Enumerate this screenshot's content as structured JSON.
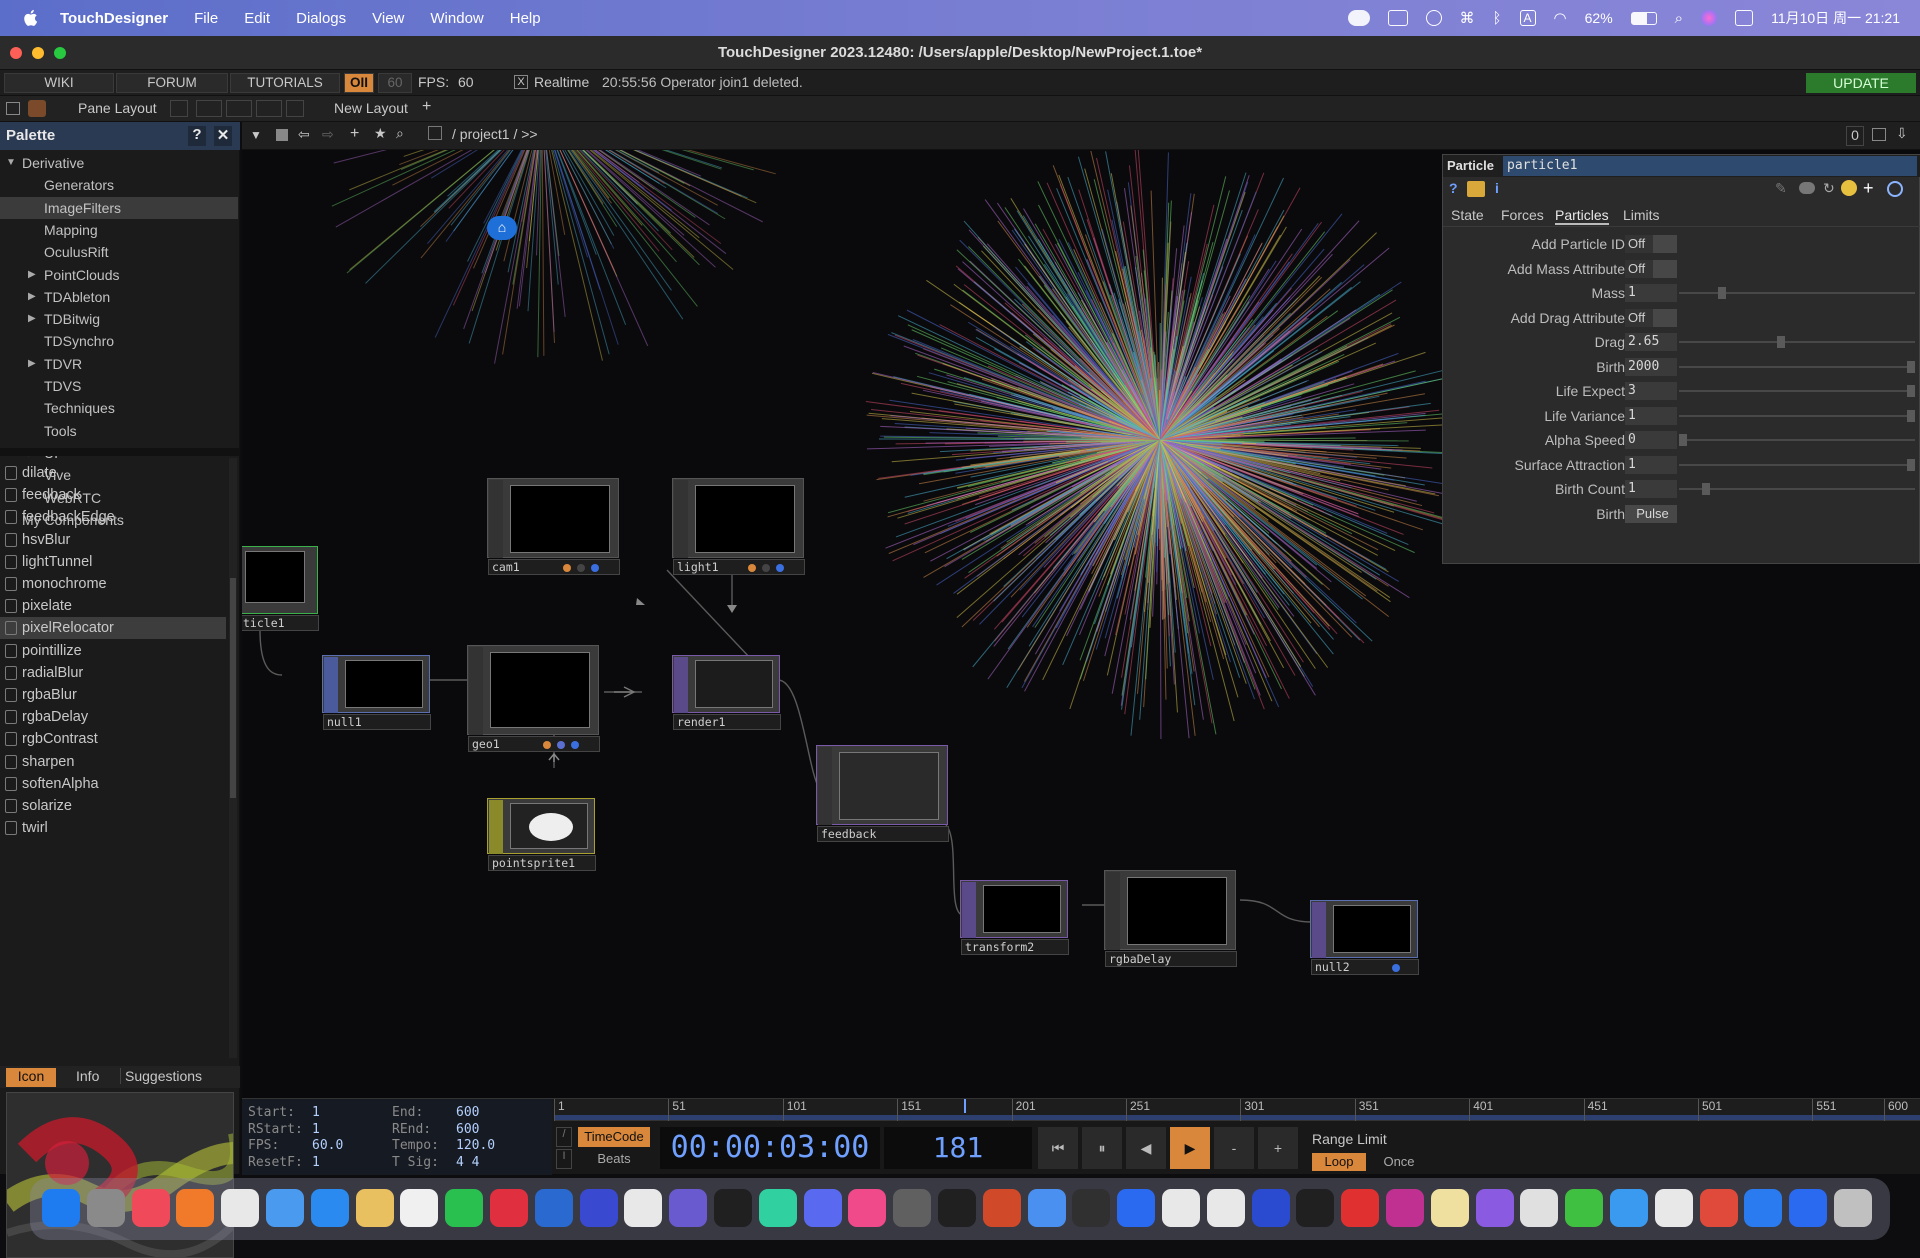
{
  "menubar": {
    "app": "TouchDesigner",
    "items": [
      "File",
      "Edit",
      "Dialogs",
      "View",
      "Window",
      "Help"
    ],
    "battery": "62%",
    "datetime": "11月10日 周一  21:21"
  },
  "window": {
    "title": "TouchDesigner 2023.12480: /Users/apple/Desktop/NewProject.1.toe*"
  },
  "toolbar": {
    "tabs": [
      "WIKI",
      "FORUM",
      "TUTORIALS"
    ],
    "oi_label": "OII",
    "fps_cap": "60",
    "fps_label": "FPS:",
    "fps_value": "60",
    "realtime_check": "X",
    "realtime_label": "Realtime",
    "status": "20:55:56 Operator join1 deleted.",
    "update": "UPDATE",
    "pane_layout": "Pane Layout",
    "new_layout": "New Layout",
    "plus": "+"
  },
  "palette": {
    "title": "Palette",
    "help": "?",
    "close": "✕",
    "tree": [
      {
        "label": "Derivative",
        "level": 0,
        "arrow": "▼"
      },
      {
        "label": "Generators",
        "level": 1,
        "arrow": ""
      },
      {
        "label": "ImageFilters",
        "level": 1,
        "arrow": "",
        "selected": true
      },
      {
        "label": "Mapping",
        "level": 1,
        "arrow": ""
      },
      {
        "label": "OculusRift",
        "level": 1,
        "arrow": ""
      },
      {
        "label": "PointClouds",
        "level": 1,
        "arrow": "▶"
      },
      {
        "label": "TDAbleton",
        "level": 1,
        "arrow": "▶"
      },
      {
        "label": "TDBitwig",
        "level": 1,
        "arrow": "▶"
      },
      {
        "label": "TDSynchro",
        "level": 1,
        "arrow": ""
      },
      {
        "label": "TDVR",
        "level": 1,
        "arrow": "▶"
      },
      {
        "label": "TDVS",
        "level": 1,
        "arrow": ""
      },
      {
        "label": "Techniques",
        "level": 1,
        "arrow": ""
      },
      {
        "label": "Tools",
        "level": 1,
        "arrow": ""
      },
      {
        "label": "UI",
        "level": 1,
        "arrow": "▶"
      },
      {
        "label": "Vive",
        "level": 1,
        "arrow": ""
      },
      {
        "label": "WebRTC",
        "level": 1,
        "arrow": ""
      },
      {
        "label": "My Components",
        "level": 0,
        "arrow": ""
      }
    ],
    "components": [
      "dilate",
      "feedback",
      "feedbackEdge",
      "hsvBlur",
      "lightTunnel",
      "monochrome",
      "pixelate",
      "pixelRelocator",
      "pointillize",
      "radialBlur",
      "rgbaBlur",
      "rgbaDelay",
      "rgbContrast",
      "sharpen",
      "softenAlpha",
      "solarize",
      "twirl"
    ],
    "selected_component": "pixelRelocator",
    "preview_tabs": [
      "Icon",
      "Info",
      "Suggestions"
    ]
  },
  "pathbar": {
    "path": "/ project1 / >>",
    "zero": "0"
  },
  "nodes": {
    "particle1": "ticle1",
    "null1": "null1",
    "cam1": "cam1",
    "geo1": "geo1",
    "light1": "light1",
    "render1": "render1",
    "pointsprite1": "pointsprite1",
    "feedback": "feedback",
    "transform2": "transform2",
    "rgbaDelay": "rgbaDelay",
    "null2": "null2"
  },
  "params": {
    "op_type": "Particle",
    "op_name": "particle1",
    "tabs": [
      "State",
      "Forces",
      "Particles",
      "Limits"
    ],
    "active_tab": "Particles",
    "rows": [
      {
        "label": "Add Particle ID",
        "value": "Off",
        "kind": "toggle"
      },
      {
        "label": "Add Mass Attribute",
        "value": "Off",
        "kind": "toggle"
      },
      {
        "label": "Mass",
        "value": "1",
        "kind": "slider",
        "slider": 0.17
      },
      {
        "label": "Add Drag Attribute",
        "value": "Off",
        "kind": "toggle"
      },
      {
        "label": "Drag",
        "value": "2.65",
        "kind": "slider",
        "slider": 0.43
      },
      {
        "label": "Birth",
        "value": "2000",
        "kind": "slider",
        "slider": 1.0
      },
      {
        "label": "Life Expect",
        "value": "3",
        "kind": "slider",
        "slider": 1.0
      },
      {
        "label": "Life Variance",
        "value": "1",
        "kind": "slider",
        "slider": 1.0
      },
      {
        "label": "Alpha Speed",
        "value": "0",
        "kind": "slider",
        "slider": 0.0
      },
      {
        "label": "Surface Attraction",
        "value": "1",
        "kind": "slider",
        "slider": 1.0
      },
      {
        "label": "Birth Count",
        "value": "1",
        "kind": "slider",
        "slider": 0.1
      },
      {
        "label": "Birth",
        "value": "Pulse",
        "kind": "button"
      }
    ]
  },
  "timeline": {
    "info": [
      {
        "k": "Start:",
        "v": "1"
      },
      {
        "k": "End:",
        "v": "600"
      },
      {
        "k": "RStart:",
        "v": "1"
      },
      {
        "k": "REnd:",
        "v": "600"
      },
      {
        "k": "FPS:",
        "v": "60.0"
      },
      {
        "k": "Tempo:",
        "v": "120.0"
      },
      {
        "k": "ResetF:",
        "v": "1"
      },
      {
        "k": "T Sig:",
        "v": "4  4"
      }
    ],
    "ticks": [
      "1",
      "51",
      "101",
      "151",
      "201",
      "251",
      "301",
      "351",
      "401",
      "451",
      "501",
      "551",
      "600"
    ],
    "timecode_label": "TimeCode",
    "beats_label": "Beats",
    "timecode": "00:00:03:00",
    "frame": "181",
    "range_limit": "Range Limit",
    "loop": "Loop",
    "once": "Once",
    "minus": "-",
    "plus": "+",
    "playhead_fraction": 0.3
  },
  "colors": {
    "accent_orange": "#d9873b",
    "selection_blue": "#2a3a52",
    "update_green": "#2c7a2c"
  }
}
